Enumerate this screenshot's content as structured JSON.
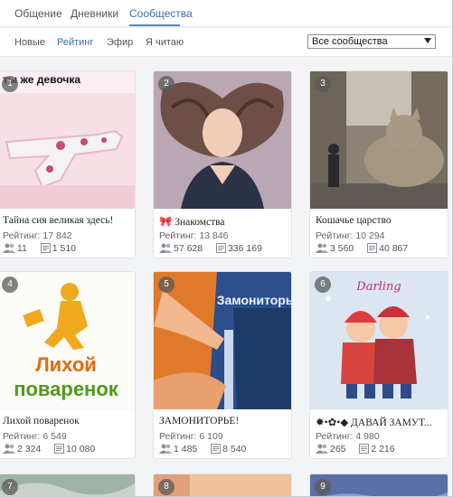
{
  "top_tabs": [
    {
      "label": "Общение"
    },
    {
      "label": "Дневники"
    },
    {
      "label": "Сообщества"
    }
  ],
  "sub_tabs": [
    {
      "label": "Новые"
    },
    {
      "label": "Рейтинг"
    },
    {
      "label": "Эфир"
    },
    {
      "label": "Я читаю"
    }
  ],
  "filter": {
    "selected": "Все сообщества"
  },
  "cards": [
    {
      "num": "1",
      "thumb_text": "ты же девочка",
      "title": "Тайна сия великая здесь!",
      "rating": "Рейтинг: 17 842",
      "members": "11",
      "posts": "1 510"
    },
    {
      "num": "2",
      "title": "🎀 Знакомства",
      "rating": "Рейтинг: 13 846",
      "members": "57 628",
      "posts": "336 169"
    },
    {
      "num": "3",
      "title": "Кошачье царство",
      "rating": "Рейтинг: 10 294",
      "members": "3 560",
      "posts": "40 867"
    },
    {
      "num": "4",
      "thumb_text": "Лихой поваренок",
      "title": "Лихой поваренок",
      "rating": "Рейтинг: 6 549",
      "members": "2 324",
      "posts": "10 080"
    },
    {
      "num": "5",
      "thumb_text": "Замониторье",
      "title": "ЗАМОНИТОРЬЕ!",
      "rating": "Рейтинг: 6 109",
      "members": "1 485",
      "posts": "8 540"
    },
    {
      "num": "6",
      "thumb_text": "Darling",
      "title": "✸•✿•◆ ДАВАЙ ЗАМУТ...",
      "rating": "Рейтинг: 4 980",
      "members": "265",
      "posts": "2 216"
    },
    {
      "num": "7"
    },
    {
      "num": "8"
    },
    {
      "num": "9"
    }
  ],
  "colors": {
    "accent": "#3b6ea8",
    "underline": "#5b86c0"
  }
}
